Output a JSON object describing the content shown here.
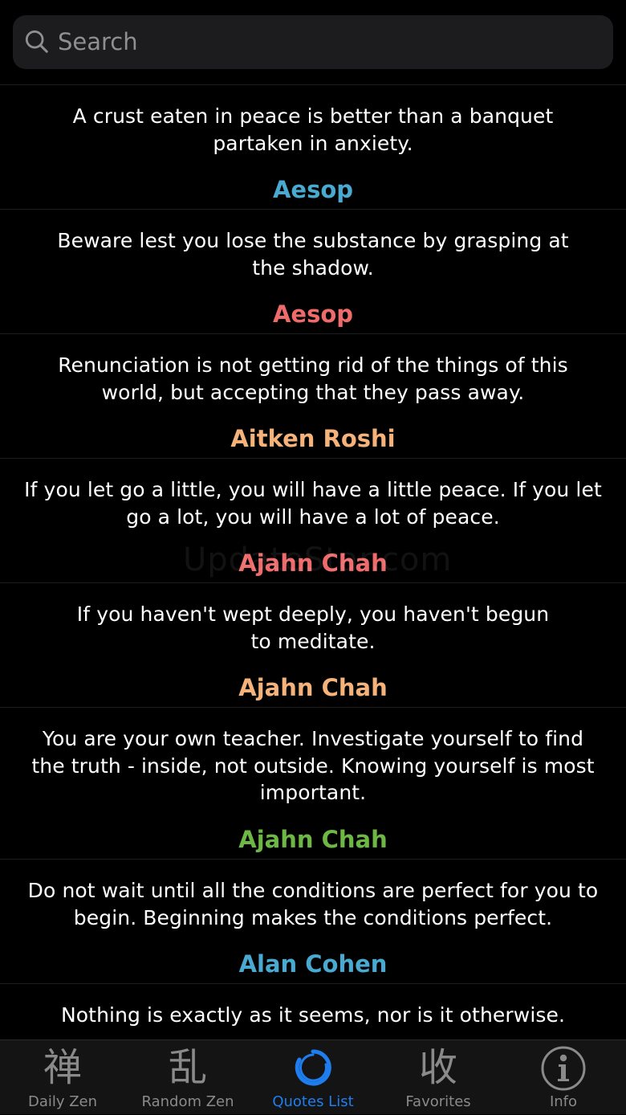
{
  "search": {
    "placeholder": "Search",
    "icon": "search-icon"
  },
  "quotes": [
    {
      "text": "A crust eaten in peace is better than a banquet partaken in anxiety.",
      "lines": [
        "A crust eaten in peace is better than a banquet",
        "partaken in anxiety."
      ],
      "author": "Aesop",
      "author_color": "#4aa9d1"
    },
    {
      "text": "Beware lest you lose the substance by grasping at the shadow.",
      "lines": [
        "Beware lest you lose the substance by grasping at",
        "the shadow."
      ],
      "author": "Aesop",
      "author_color": "#ef6b6b"
    },
    {
      "text": "Renunciation is not getting rid of the things of this world, but accepting that they pass away.",
      "lines": [
        "Renunciation is not getting rid of the things of this",
        "world, but accepting that they pass away."
      ],
      "author": "Aitken Roshi",
      "author_color": "#f5b27a"
    },
    {
      "text": "If you let go a little, you will have a little peace. If you let go a lot, you will have a lot of peace.",
      "lines": [
        "If you let go a little, you will have a little peace. If you let",
        "go a lot, you will have a lot of peace."
      ],
      "author": "Ajahn Chah",
      "author_color": "#ef6b6b"
    },
    {
      "text": "If you haven't wept deeply, you haven't begun to meditate.",
      "lines": [
        "If you haven't wept deeply, you haven't begun",
        "to meditate."
      ],
      "author": "Ajahn Chah",
      "author_color": "#f5b27a"
    },
    {
      "text": "You are your own teacher. Investigate yourself to find the truth - inside, not outside. Knowing yourself is most important.",
      "lines": [
        "You are your own teacher. Investigate yourself to find",
        "the truth - inside, not outside. Knowing yourself is most",
        "important."
      ],
      "author": "Ajahn Chah",
      "author_color": "#6db845"
    },
    {
      "text": "Do not wait until all the conditions are perfect for you to begin. Beginning makes the conditions perfect.",
      "lines": [
        "Do not wait until all the conditions are perfect for you to",
        "begin. Beginning makes the conditions perfect."
      ],
      "author": "Alan Cohen",
      "author_color": "#4aa9d1"
    },
    {
      "text": "Nothing is exactly as it seems, nor is it otherwise.",
      "lines": [
        "Nothing is exactly as it seems, nor is it otherwise."
      ],
      "author": "",
      "author_color": "#ffffff"
    }
  ],
  "watermark": "UpdateStar.com",
  "tabs": [
    {
      "label": "Daily Zen",
      "glyph": "禅",
      "icon": "zen-character-icon",
      "active": false
    },
    {
      "label": "Random Zen",
      "glyph": "乱",
      "icon": "random-character-icon",
      "active": false
    },
    {
      "label": "Quotes List",
      "glyph": "",
      "icon": "enso-circle-icon",
      "active": true
    },
    {
      "label": "Favorites",
      "glyph": "收",
      "icon": "favorites-character-icon",
      "active": false
    },
    {
      "label": "Info",
      "glyph": "",
      "icon": "info-icon",
      "active": false
    }
  ],
  "colors": {
    "active_tab": "#1e7ef0",
    "inactive_tab": "#8a8a8a",
    "background": "#000000"
  }
}
